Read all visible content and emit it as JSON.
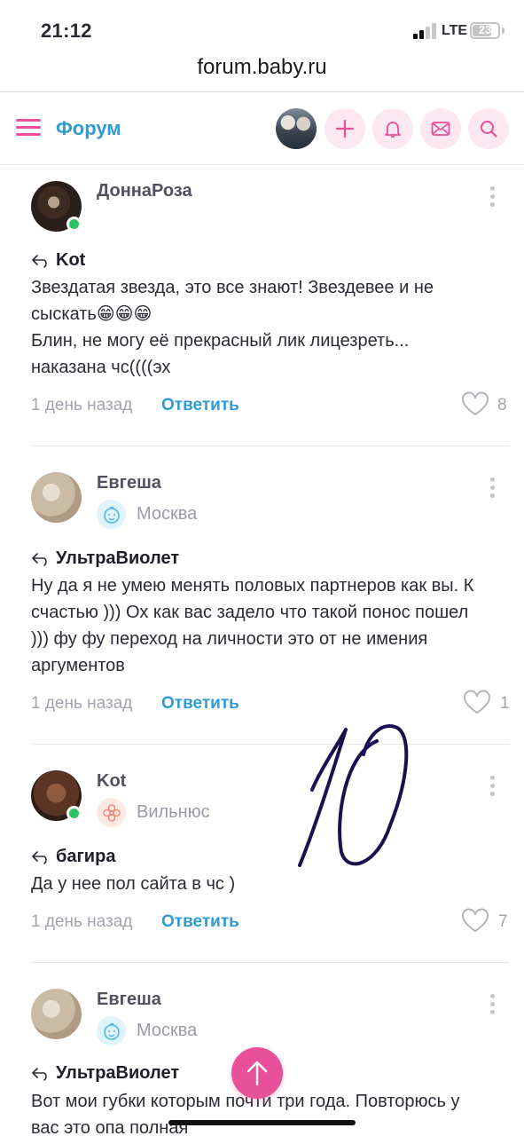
{
  "status_bar": {
    "time": "21:12",
    "network": "LTE",
    "battery": "23"
  },
  "browser": {
    "url": "forum.baby.ru"
  },
  "header": {
    "title": "Форум",
    "icons": [
      "menu-icon",
      "avatar",
      "plus-icon",
      "bell-icon",
      "mail-icon",
      "search-icon"
    ]
  },
  "posts": [
    {
      "author": "ДоннаРоза",
      "city": "",
      "online": true,
      "reply_to": "Kot",
      "lines": [
        "Звездатая звезда, это все знают! Звездевее и не",
        "сыскать😁😁😁",
        "Блин, не могу её прекрасный лик лицезреть...",
        "наказана чс((((эх"
      ],
      "time": "1 день назад",
      "answer": "Ответить",
      "likes": "8"
    },
    {
      "author": "Евгеша",
      "city": "Москва",
      "online": false,
      "reply_to": "УльтраВиолет",
      "lines": [
        "Ну да я не умею менять половых партнеров как вы. К",
        "счастью ))) Ох как вас задело что такой понос пошел",
        "))) фу фу переход на личности это от не имения",
        "аргументов"
      ],
      "time": "1 день назад",
      "answer": "Ответить",
      "likes": "1"
    },
    {
      "author": "Kot",
      "city": "Вильнюс",
      "online": true,
      "reply_to": "багира",
      "lines": [
        "Да у нее пол сайта в чс )"
      ],
      "time": "1 день назад",
      "answer": "Ответить",
      "likes": "7"
    },
    {
      "author": "Евгеша",
      "city": "Москва",
      "online": false,
      "reply_to": "УльтраВиолет",
      "lines": [
        "Вот мои губки которым почти три года. Повторюсь у",
        "вас это опа полная"
      ]
    }
  ],
  "colors": {
    "accent": "#e9509a",
    "link": "#2f9bd4",
    "online": "#2ec264"
  }
}
